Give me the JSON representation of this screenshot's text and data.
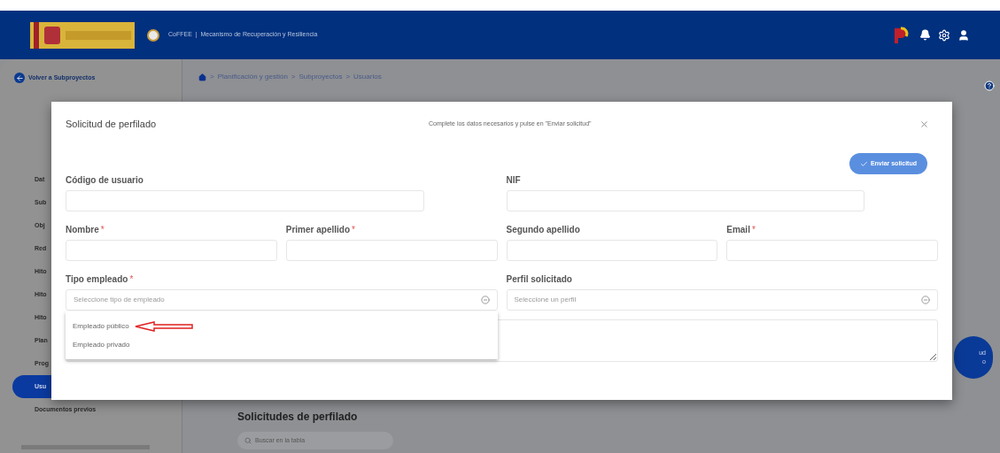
{
  "header": {
    "app_title": "CoFFEE  |  Mecanismo de Recuperación y Resiliencia"
  },
  "sidebar": {
    "back_link": "Volver a Subproyectos",
    "items": [
      {
        "label": "Dat",
        "selected": false
      },
      {
        "label": "Sub",
        "selected": false
      },
      {
        "label": "Obj",
        "selected": false
      },
      {
        "label": "Red",
        "selected": false
      },
      {
        "label": "Hito",
        "selected": false
      },
      {
        "label": "Hito",
        "selected": false
      },
      {
        "label": "Hito",
        "selected": false
      },
      {
        "label": "Plan",
        "selected": false
      },
      {
        "label": "Prog",
        "selected": false
      },
      {
        "label": "Usu",
        "selected": true
      },
      {
        "label": "Documentos previos",
        "selected": false
      }
    ]
  },
  "breadcrumb": [
    {
      "separator": ">",
      "label": "Planificación y gestión"
    },
    {
      "separator": ">",
      "label": "Subproyectos"
    },
    {
      "separator": ">",
      "label": "Usuarios"
    }
  ],
  "main": {
    "section_title": "Solicitudes de perfilado",
    "search": {
      "placeholder": "Buscar en la tabla"
    },
    "partial_button": [
      "ud",
      "o"
    ]
  },
  "modal": {
    "title": "Solicitud de perfilado",
    "subtitle": "Complete los datos necesarios y pulse en \"Enviar solicitud\"",
    "submit": "Enviar solicitud",
    "fields": [
      {
        "kind": "wide_text",
        "label": "Código de usuario"
      },
      {
        "kind": "wide_text",
        "label": "NIF"
      },
      {
        "kind": "text",
        "label": "Nombre",
        "required_mark": "*"
      },
      {
        "kind": "text",
        "label": "Primer apellido",
        "required_mark": "*"
      },
      {
        "kind": "text",
        "label": "Segundo apellido"
      },
      {
        "kind": "text",
        "label": "Email",
        "required_mark": "*"
      },
      {
        "kind": "select",
        "label": "Tipo empleado",
        "required_mark": "*",
        "placeholder": "Seleccione tipo de empleado",
        "options": [
          "Empleado público",
          "Empleado privado"
        ]
      },
      {
        "kind": "select",
        "label": "Perfil solicitado",
        "placeholder": "Seleccione un perfil"
      },
      {
        "kind": "textarea"
      }
    ]
  }
}
